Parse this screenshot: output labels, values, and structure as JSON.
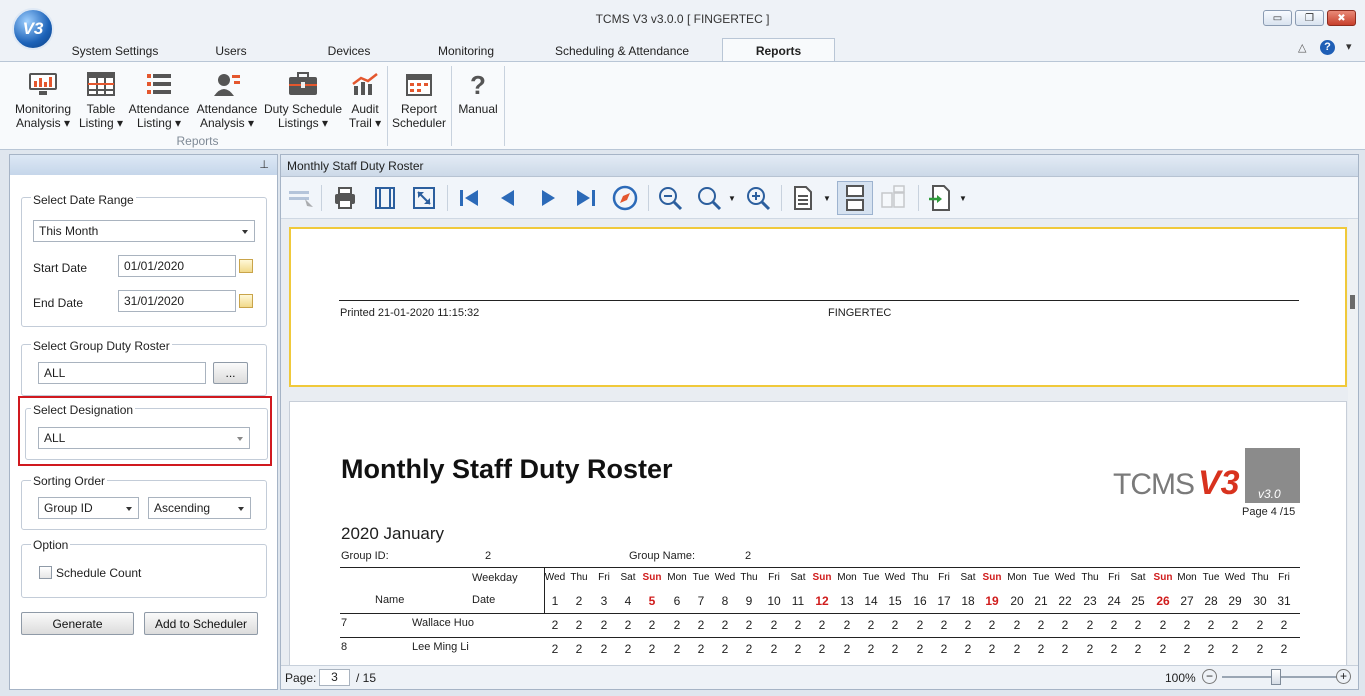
{
  "window": {
    "title": "TCMS V3 v3.0.0 [ FINGERTEC ]",
    "logo_text": "V3",
    "minimize": "▭",
    "restore": "❐",
    "close": "✖"
  },
  "tabs": [
    "System Settings",
    "Users",
    "Devices",
    "Monitoring",
    "Scheduling & Attendance",
    "Reports"
  ],
  "tab_icons": {
    "collapse": "△",
    "help": "?",
    "menu": "▾"
  },
  "ribbon": {
    "buttons": [
      {
        "line1": "Monitoring",
        "line2": "Analysis ▾"
      },
      {
        "line1": "Table",
        "line2": "Listing ▾"
      },
      {
        "line1": "Attendance",
        "line2": "Listing ▾"
      },
      {
        "line1": "Attendance",
        "line2": "Analysis ▾"
      },
      {
        "line1": "Duty Schedule",
        "line2": "Listings ▾"
      },
      {
        "line1": "Audit",
        "line2": "Trail ▾"
      },
      {
        "line1": "Report",
        "line2": "Scheduler"
      },
      {
        "line1": "Manual",
        "line2": ""
      }
    ],
    "group_label": "Reports"
  },
  "left_panel": {
    "pin": "⊥",
    "date_range": {
      "title": "Select Date Range",
      "value": "This Month",
      "start_label": "Start Date",
      "start_value": "01/01/2020",
      "end_label": "End Date",
      "end_value": "31/01/2020"
    },
    "group_roster": {
      "title": "Select Group Duty Roster",
      "value": "ALL",
      "browse": "..."
    },
    "designation": {
      "title": "Select Designation",
      "value": "ALL"
    },
    "sorting": {
      "title": "Sorting Order",
      "field": "Group ID",
      "direction": "Ascending"
    },
    "option": {
      "title": "Option",
      "checkbox": "Schedule Count"
    },
    "generate": "Generate",
    "add_scheduler": "Add to Scheduler"
  },
  "viewer": {
    "title": "Monthly Staff Duty Roster",
    "prev_page": {
      "printed": "Printed 21-01-2020 11:15:32",
      "company": "FINGERTEC"
    },
    "report": {
      "title": "Monthly Staff Duty Roster",
      "logo_text": "TCMS",
      "logo_v": "V3",
      "logo_version": "v3.0",
      "page_info": "Page 4 /15",
      "period": "2020 January",
      "group_id_label": "Group ID:",
      "group_id": "2",
      "group_name_label": "Group Name:",
      "group_name": "2",
      "weekday_label": "Weekday",
      "name_label": "Name",
      "date_label": "Date",
      "weekdays": [
        "Wed",
        "Thu",
        "Fri",
        "Sat",
        "Sun",
        "Mon",
        "Tue",
        "Wed",
        "Thu",
        "Fri",
        "Sat",
        "Sun",
        "Mon",
        "Tue",
        "Wed",
        "Thu",
        "Fri",
        "Sat",
        "Sun",
        "Mon",
        "Tue",
        "Wed",
        "Thu",
        "Fri",
        "Sat",
        "Sun",
        "Mon",
        "Tue",
        "Wed",
        "Thu",
        "Fri"
      ],
      "dates": [
        "1",
        "2",
        "3",
        "4",
        "5",
        "6",
        "7",
        "8",
        "9",
        "10",
        "11",
        "12",
        "13",
        "14",
        "15",
        "16",
        "17",
        "18",
        "19",
        "20",
        "21",
        "22",
        "23",
        "24",
        "25",
        "26",
        "27",
        "28",
        "29",
        "30",
        "31"
      ],
      "rows": [
        {
          "id": "7",
          "name": "Wallace Huo",
          "values": [
            "2",
            "2",
            "2",
            "2",
            "2",
            "2",
            "2",
            "2",
            "2",
            "2",
            "2",
            "2",
            "2",
            "2",
            "2",
            "2",
            "2",
            "2",
            "2",
            "2",
            "2",
            "2",
            "2",
            "2",
            "2",
            "2",
            "2",
            "2",
            "2",
            "2",
            "2"
          ]
        },
        {
          "id": "8",
          "name": "Lee Ming Li",
          "values": [
            "2",
            "2",
            "2",
            "2",
            "2",
            "2",
            "2",
            "2",
            "2",
            "2",
            "2",
            "2",
            "2",
            "2",
            "2",
            "2",
            "2",
            "2",
            "2",
            "2",
            "2",
            "2",
            "2",
            "2",
            "2",
            "2",
            "2",
            "2",
            "2",
            "2",
            "2"
          ]
        }
      ]
    },
    "status": {
      "page_label": "Page:",
      "page_value": "3",
      "page_total": "/ 15",
      "zoom": "100%"
    }
  },
  "colors": {
    "sunday": "#d01c1c",
    "highlight": "#d0191f",
    "prev_page_border": "#f0c93a"
  }
}
